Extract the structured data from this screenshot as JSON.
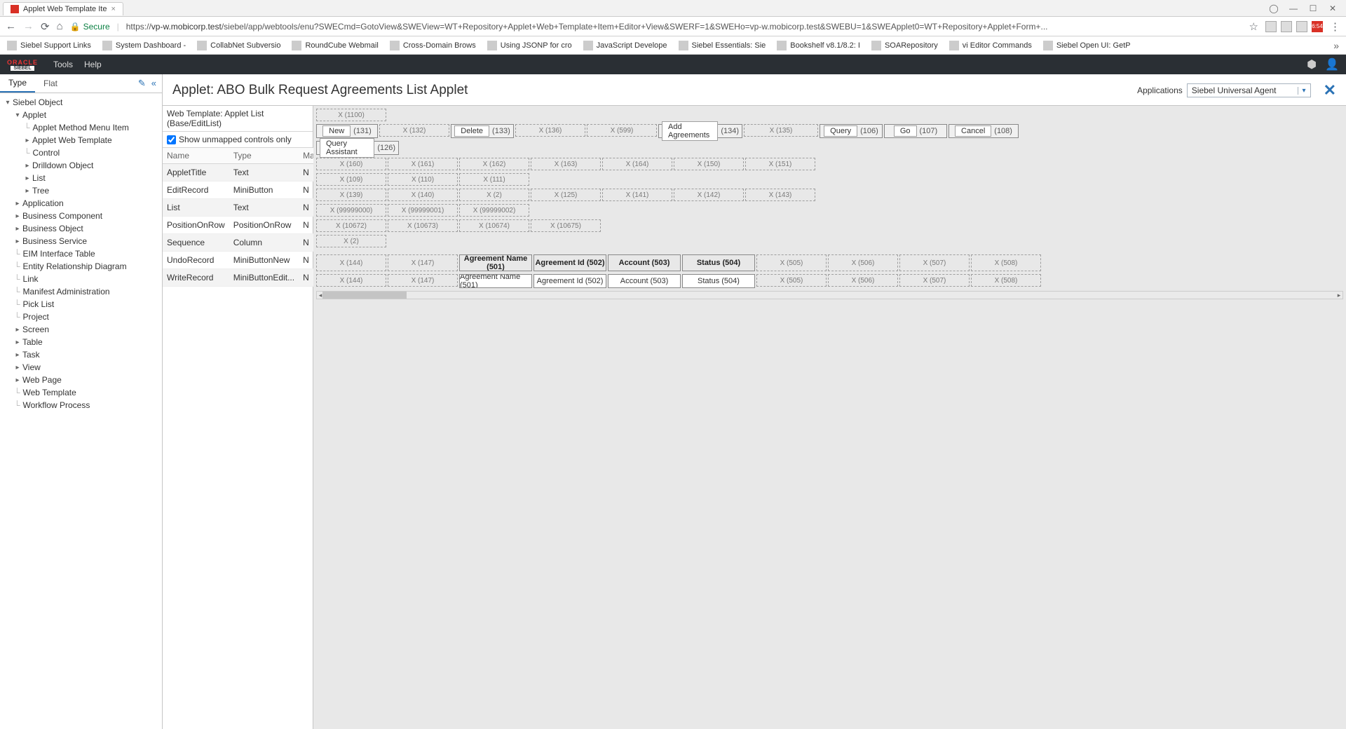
{
  "browser": {
    "tab_title": "Applet Web Template Ite",
    "secure_label": "Secure",
    "url_prefix": "https://",
    "url_host": "vp-w.mobicorp.test",
    "url_path": "/siebel/app/webtools/enu?SWECmd=GotoView&SWEView=WT+Repository+Applet+Web+Template+Item+Editor+View&SWERF=1&SWEHo=vp-w.mobicorp.test&SWEBU=1&SWEApplet0=WT+Repository+Applet+Form+...",
    "ext_time": "6:54",
    "bookmarks": [
      "Siebel Support Links",
      "System Dashboard - ",
      "CollabNet Subversio",
      "RoundCube Webmail",
      "Cross-Domain Brows",
      "Using JSONP for cro",
      "JavaScript Develope",
      "Siebel Essentials: Sie",
      "Bookshelf v8.1/8.2: I",
      "SOARepository",
      "vi Editor Commands",
      "Siebel Open UI: GetP"
    ]
  },
  "app_menu": {
    "tools": "Tools",
    "help": "Help"
  },
  "sidebar": {
    "tabs": {
      "type": "Type",
      "flat": "Flat"
    },
    "tree": [
      {
        "label": "Siebel Object",
        "depth": 0,
        "toggle": "▾"
      },
      {
        "label": "Applet",
        "depth": 1,
        "toggle": "▾"
      },
      {
        "label": "Applet Method Menu Item",
        "depth": 2,
        "leaf": true
      },
      {
        "label": "Applet Web Template",
        "depth": 2,
        "toggle": "▸"
      },
      {
        "label": "Control",
        "depth": 2,
        "leaf": true
      },
      {
        "label": "Drilldown Object",
        "depth": 2,
        "toggle": "▸"
      },
      {
        "label": "List",
        "depth": 2,
        "toggle": "▸"
      },
      {
        "label": "Tree",
        "depth": 2,
        "toggle": "▸"
      },
      {
        "label": "Application",
        "depth": 1,
        "toggle": "▸"
      },
      {
        "label": "Business Component",
        "depth": 1,
        "toggle": "▸"
      },
      {
        "label": "Business Object",
        "depth": 1,
        "toggle": "▸"
      },
      {
        "label": "Business Service",
        "depth": 1,
        "toggle": "▸"
      },
      {
        "label": "EIM Interface Table",
        "depth": 1,
        "leaf": true
      },
      {
        "label": "Entity Relationship Diagram",
        "depth": 1,
        "leaf": true
      },
      {
        "label": "Link",
        "depth": 1,
        "leaf": true
      },
      {
        "label": "Manifest Administration",
        "depth": 1,
        "leaf": true
      },
      {
        "label": "Pick List",
        "depth": 1,
        "leaf": true
      },
      {
        "label": "Project",
        "depth": 1,
        "leaf": true
      },
      {
        "label": "Screen",
        "depth": 1,
        "toggle": "▸"
      },
      {
        "label": "Table",
        "depth": 1,
        "toggle": "▸"
      },
      {
        "label": "Task",
        "depth": 1,
        "toggle": "▸"
      },
      {
        "label": "View",
        "depth": 1,
        "toggle": "▸"
      },
      {
        "label": "Web Page",
        "depth": 1,
        "toggle": "▸"
      },
      {
        "label": "Web Template",
        "depth": 1,
        "leaf": true
      },
      {
        "label": "Workflow Process",
        "depth": 1,
        "leaf": true
      }
    ]
  },
  "page": {
    "title": "Applet: ABO Bulk Request Agreements List Applet",
    "web_template_label": "Web Template:",
    "web_template_value": "Applet List (Base/EditList)",
    "show_unmapped_label": "Show unmapped controls only",
    "applications_label": "Applications",
    "application_value": "Siebel Universal Agent"
  },
  "control_table": {
    "headers": {
      "name": "Name",
      "type": "Type",
      "mapped": "Mapped"
    },
    "rows": [
      {
        "name": "AppletTitle",
        "type": "Text",
        "mapped": "N"
      },
      {
        "name": "EditRecord",
        "type": "MiniButton",
        "mapped": "N"
      },
      {
        "name": "List",
        "type": "Text",
        "mapped": "N"
      },
      {
        "name": "PositionOnRow",
        "type": "PositionOnRow",
        "mapped": "N"
      },
      {
        "name": "Sequence",
        "type": "Column",
        "mapped": "N"
      },
      {
        "name": "UndoRecord",
        "type": "MiniButtonNew",
        "mapped": "N"
      },
      {
        "name": "WriteRecord",
        "type": "MiniButtonEdit...",
        "mapped": "N"
      }
    ]
  },
  "layout": {
    "top_slot": "X (1100)",
    "btn_row": [
      {
        "btn": "New",
        "num": "(131)"
      },
      {
        "slot": "X (132)"
      },
      {
        "btn": "Delete",
        "num": "(133)"
      },
      {
        "slot": "X (136)"
      },
      {
        "slot": "X (599)"
      },
      {
        "btn": "Add Agreements",
        "num": "(134)"
      },
      {
        "slot": "X (135)"
      },
      {
        "btn": "Query",
        "num": "(106)"
      },
      {
        "btn": "Go",
        "num": "(107)"
      },
      {
        "btn": "Cancel",
        "num": "(108)"
      }
    ],
    "qa_row": [
      {
        "btn": "Query Assistant",
        "num": "(126)"
      }
    ],
    "grid_rows": [
      [
        "X (160)",
        "X (161)",
        "X (162)",
        "X (163)",
        "X (164)",
        "X (150)",
        "X (151)"
      ],
      [
        "X (109)",
        "X (110)",
        "X (111)"
      ],
      [
        "X (139)",
        "X (140)",
        "X (2)",
        "X (125)",
        "X (141)",
        "X (142)",
        "X (143)"
      ],
      [
        "X (99999000)",
        "X (99999001)",
        "X (99999002)"
      ],
      [
        "X (10672)",
        "X (10673)",
        "X (10674)",
        "X (10675)"
      ],
      [
        "X (2)"
      ]
    ],
    "header_row": [
      "X (144)",
      "X (147)",
      "Agreement Name (501)",
      "Agreement Id (502)",
      "Account (503)",
      "Status (504)",
      "X (505)",
      "X (506)",
      "X (507)",
      "X (508)"
    ],
    "data_row": [
      "X (144)",
      "X (147)",
      "Agreement Name (501)",
      "Agreement Id (502)",
      "Account (503)",
      "Status (504)",
      "X (505)",
      "X (506)",
      "X (507)",
      "X (508)"
    ]
  }
}
